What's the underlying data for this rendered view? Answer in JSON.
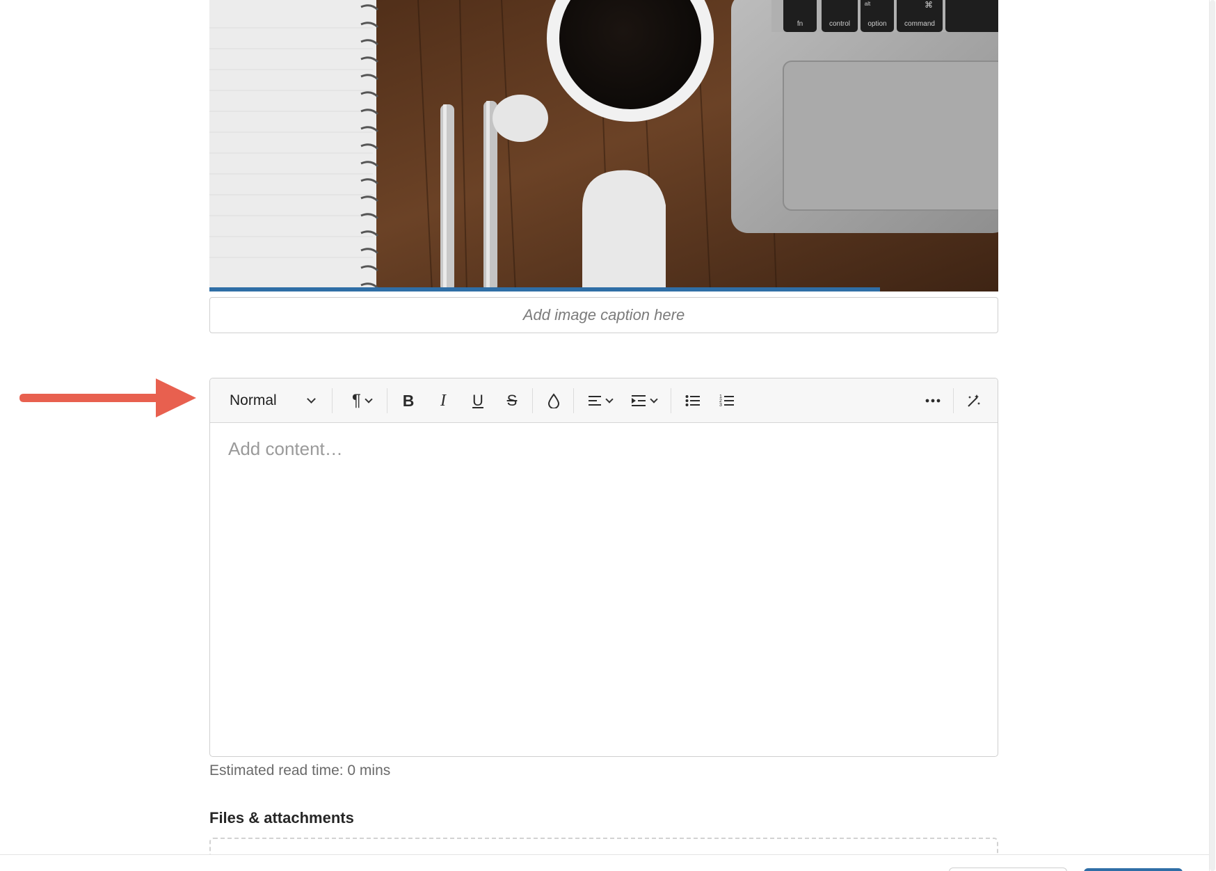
{
  "hero_image": {
    "description_icon": "photo-desk-coffee-laptop",
    "upload_progress_fraction": 0.85,
    "keys": [
      "fn",
      "control",
      "option",
      "command"
    ],
    "key_alt_label": "alt",
    "key_cmd_symbol": "⌘"
  },
  "caption": {
    "placeholder": "Add image caption here",
    "value": ""
  },
  "editor": {
    "toolbar": {
      "style_select_label": "Normal",
      "paragraph_icon": "pilcrow-icon",
      "bold_icon": "bold-icon",
      "italic_icon": "italic-icon",
      "underline_icon": "underline-icon",
      "strikethrough_icon": "strikethrough-icon",
      "color_icon": "text-color-drop-icon",
      "align_icon": "align-icon",
      "indent_icon": "indent-icon",
      "bullet_list_icon": "bullet-list-icon",
      "numbered_list_icon": "numbered-list-icon",
      "more_icon": "more-horizontal-icon",
      "magic_icon": "magic-wand-icon"
    },
    "content_placeholder": "Add content…"
  },
  "read_time": "Estimated read time: 0 mins",
  "attachments": {
    "title": "Files & attachments"
  },
  "colors": {
    "accent": "#2f6ea6",
    "arrow": "#e8604f",
    "border": "#cfcfcf",
    "toolbar_bg": "#f7f7f7"
  }
}
